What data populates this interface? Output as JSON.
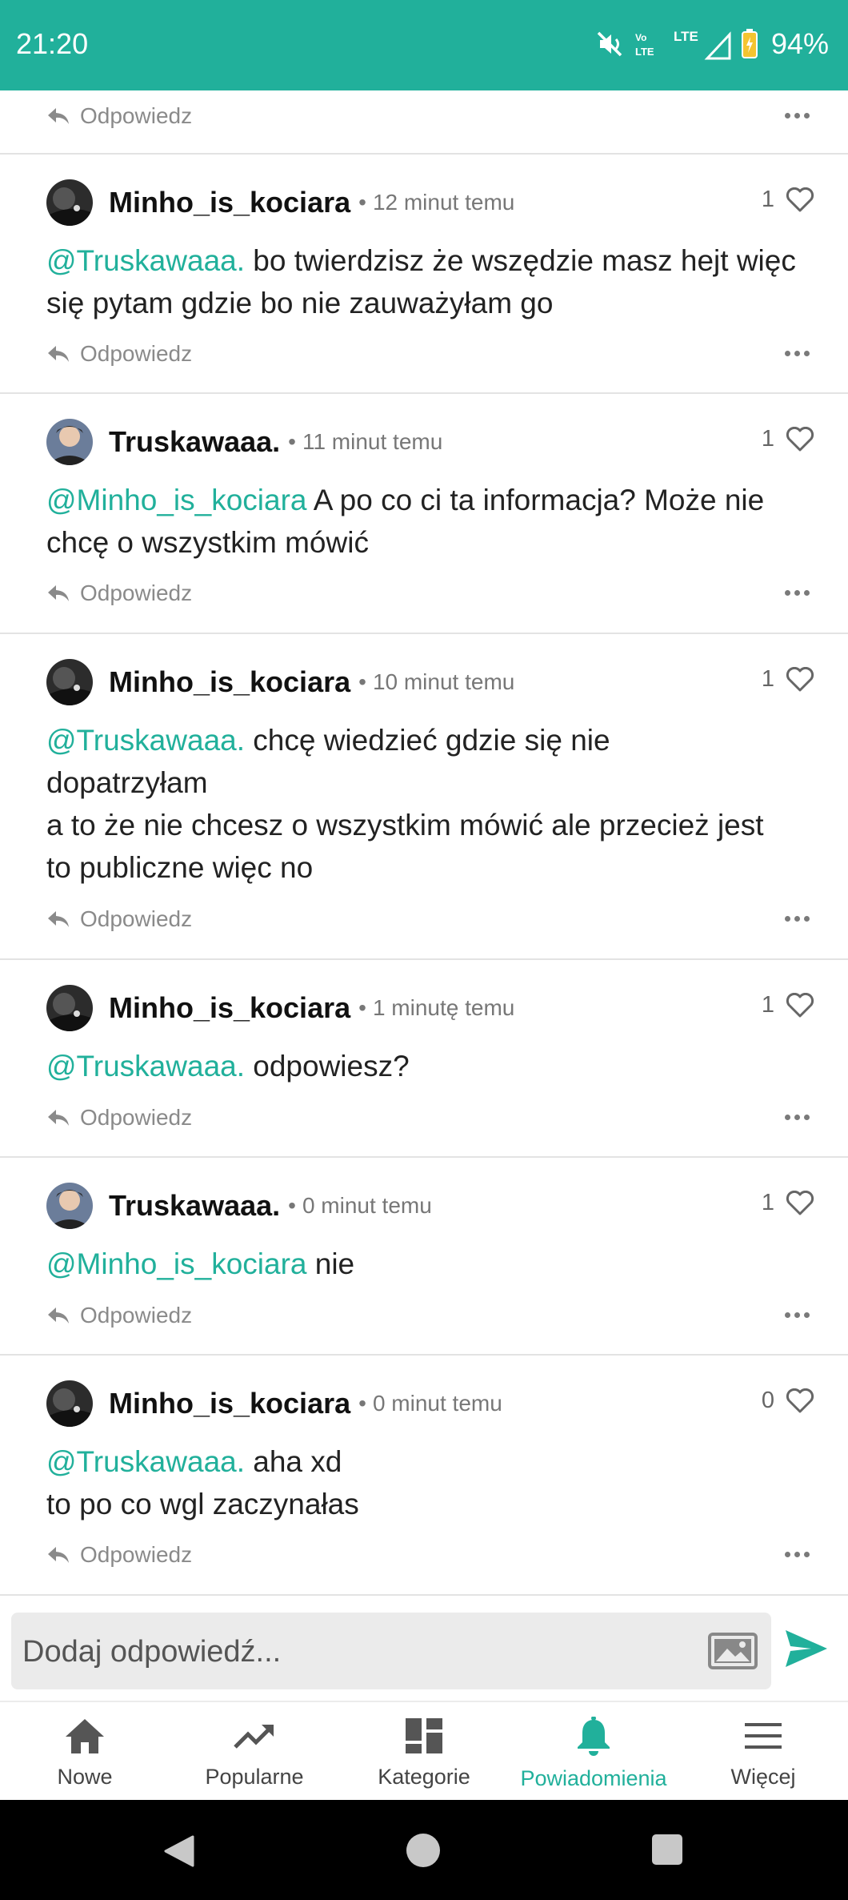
{
  "status_bar": {
    "time": "21:20",
    "battery": "94%",
    "network_label": "LTE",
    "volte_label": "VoLTE"
  },
  "reply_label": "Odpowiedz",
  "comments": [
    {
      "username": "Minho_is_kociara",
      "time": "12 minut temu",
      "likes": "1",
      "mention": "@Truskawaaa.",
      "text": " bo twierdzisz że wszędzie masz hejt więc się pytam gdzie bo nie zauważyłam go"
    },
    {
      "username": "Truskawaaa.",
      "time": "11 minut temu",
      "likes": "1",
      "mention": "@Minho_is_kociara",
      "text": " A po co ci ta informacja? Może nie chcę o wszystkim mówić"
    },
    {
      "username": "Minho_is_kociara",
      "time": "10 minut temu",
      "likes": "1",
      "mention": "@Truskawaaa.",
      "text": " chcę wiedzieć gdzie się nie dopatrzyłam\na to że nie chcesz o wszystkim mówić ale przecież jest to publiczne więc no"
    },
    {
      "username": "Minho_is_kociara",
      "time": "1 minutę temu",
      "likes": "1",
      "mention": "@Truskawaaa.",
      "text": " odpowiesz?"
    },
    {
      "username": "Truskawaaa.",
      "time": "0 minut temu",
      "likes": "1",
      "mention": "@Minho_is_kociara",
      "text": " nie"
    },
    {
      "username": "Minho_is_kociara",
      "time": "0 minut temu",
      "likes": "0",
      "mention": "@Truskawaaa.",
      "text": " aha xd\nto po co wgl zaczynałas"
    }
  ],
  "input": {
    "placeholder": "Dodaj odpowiedź..."
  },
  "bottom_nav": [
    {
      "label": "Nowe",
      "icon": "home-icon",
      "active": false
    },
    {
      "label": "Popularne",
      "icon": "trending-icon",
      "active": false
    },
    {
      "label": "Kategorie",
      "icon": "grid-icon",
      "active": false
    },
    {
      "label": "Powiadomienia",
      "icon": "bell-icon",
      "active": true
    },
    {
      "label": "Więcej",
      "icon": "menu-icon",
      "active": false
    }
  ],
  "colors": {
    "accent": "#21b09b",
    "text": "#222222",
    "muted": "#8a8a8a"
  }
}
